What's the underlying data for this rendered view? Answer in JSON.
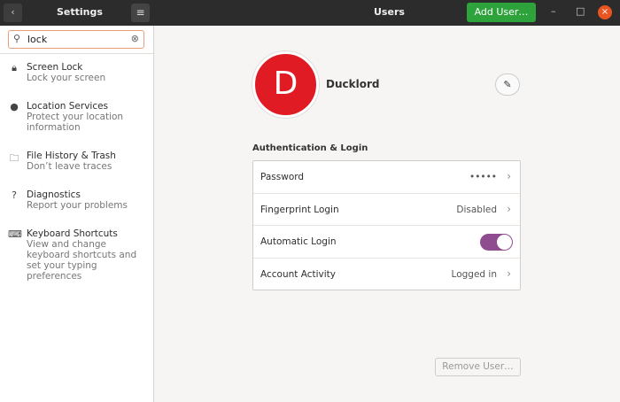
{
  "header": {
    "sidebar_title": "Settings",
    "title": "Users",
    "add_user": "Add User…",
    "back_icon": "‹",
    "menu_icon": "≡",
    "minimize": "–",
    "maximize": "□",
    "close": "×"
  },
  "search": {
    "value": "lock"
  },
  "sidebar": {
    "items": [
      {
        "title": "Screen Lock",
        "subtitle": "Lock your screen",
        "icon": "🔒︎"
      },
      {
        "title": "Location Services",
        "subtitle": "Protect your location information",
        "icon": "●"
      },
      {
        "title": "File History & Trash",
        "subtitle": "Don’t leave traces",
        "icon": "🗀"
      },
      {
        "title": "Diagnostics",
        "subtitle": "Report your problems",
        "icon": "?"
      },
      {
        "title": "Keyboard Shortcuts",
        "subtitle": "View and change keyboard shortcuts and set your typing preferences",
        "icon": "⌨"
      }
    ]
  },
  "user": {
    "initial": "D",
    "name": "Ducklord",
    "avatar_color": "#e01b24"
  },
  "auth": {
    "heading": "Authentication & Login",
    "rows": [
      {
        "label": "Password",
        "value": "•••••"
      },
      {
        "label": "Fingerprint Login",
        "value": "Disabled"
      },
      {
        "label": "Automatic Login",
        "toggle": true
      },
      {
        "label": "Account Activity",
        "value": "Logged in"
      }
    ]
  },
  "remove_user": "Remove User…"
}
